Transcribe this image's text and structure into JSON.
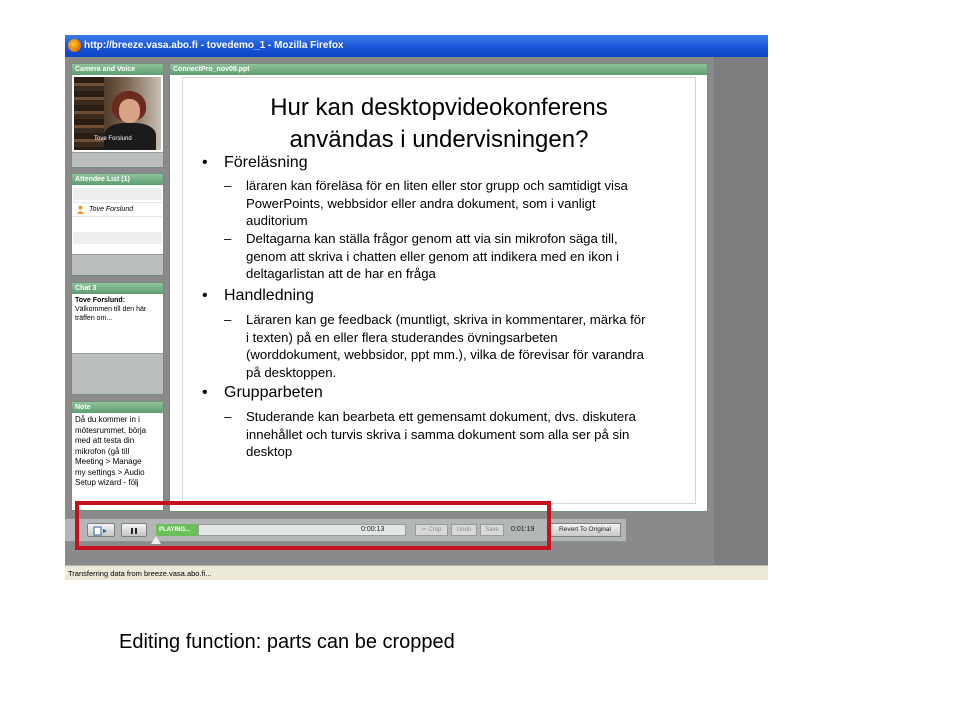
{
  "browser": {
    "title": "http://breeze.vasa.abo.fi - tovedemo_1 - Mozilla Firefox",
    "status": "Transferring data from breeze.vasa.abo.fi..."
  },
  "pods": {
    "camera": {
      "title": "Camera and Voice",
      "label": "Tove Forslund"
    },
    "attendees": {
      "title": "Attendee List (1)",
      "items": [
        "Tove Forslund"
      ]
    },
    "chat": {
      "title": "Chat 3",
      "sender": "Tove Forslund:",
      "message": "Välkommen till den här träffen om..."
    },
    "note": {
      "title": "Note",
      "lines": [
        "Då du kommer in i",
        "mötesrummet, börja",
        "med att testa din",
        "mikrofon (gå till",
        "Meeting > Manage",
        "my settings > Audio",
        "Setup wizard - följ"
      ]
    },
    "share": {
      "title": "ConnectPro_nov08.ppt"
    }
  },
  "slide": {
    "title_lines": [
      "Hur kan desktopvideokonferens",
      "användas i undervisningen?"
    ],
    "sections": [
      {
        "heading": "Föreläsning",
        "items": [
          [
            "läraren kan föreläsa för en liten eller stor grupp och samtidigt visa",
            "PowerPoints, webbsidor eller andra dokument, som i vanligt",
            "auditorium"
          ],
          [
            "Deltagarna kan ställa frågor genom att via sin mikrofon säga till,",
            "genom att skriva i chatten eller genom att indikera med en ikon i",
            "deltagarlistan att de har en fråga"
          ]
        ]
      },
      {
        "heading": "Handledning",
        "items": [
          [
            "Läraren kan ge feedback (muntligt, skriva in kommentarer, märka för",
            "i texten) på en eller flera studerandes övningsarbeten",
            "(worddokument, webbsidor, ppt mm.), vilka de förevisar för varandra",
            "på desktoppen."
          ]
        ]
      },
      {
        "heading": "Grupparbeten",
        "items": [
          [
            "Studerande kan bearbeta ett gemensamt dokument, dvs. diskutera",
            "innehållet och turvis skriva i samma dokument som alla ser på sin",
            "desktop"
          ]
        ]
      }
    ]
  },
  "player": {
    "status": "PLAYING...",
    "current_time": "0:00:13",
    "total_time": "0:01:19",
    "crop_label": "Crop",
    "undo_label": "Undo",
    "save_label": "Save",
    "revert_label": "Revert To Original"
  },
  "caption": "Editing function: parts can be cropped",
  "colors": {
    "highlight": "#c8101c",
    "pod_header": "#6fa97f",
    "titlebar": "#1653d6"
  }
}
